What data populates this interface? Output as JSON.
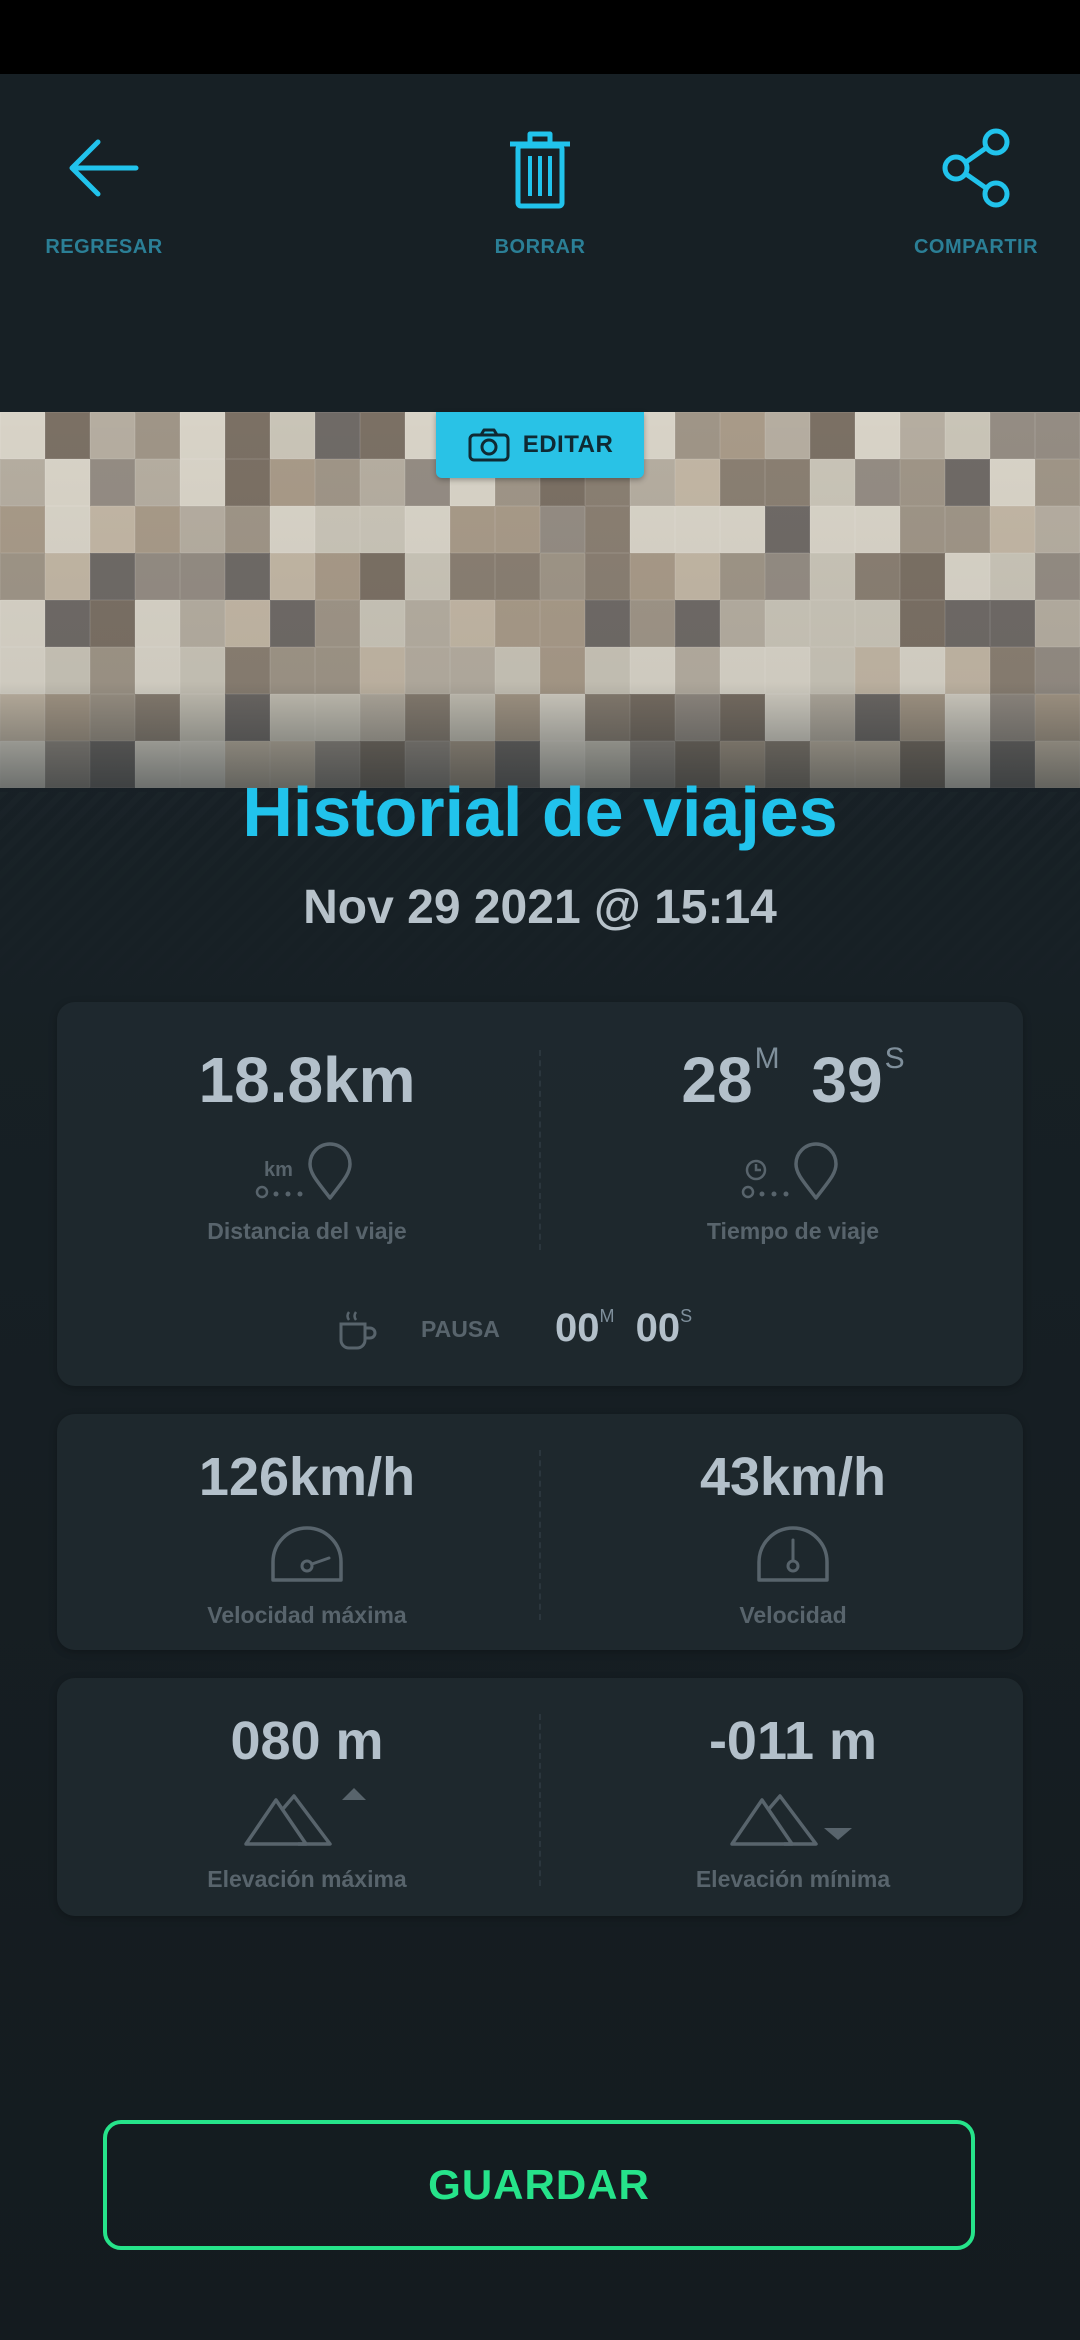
{
  "colors": {
    "accent": "#21c3ec",
    "save": "#26e38a",
    "muted_label": "#2b7f96",
    "value_text": "#b3c0ca",
    "background": "#172025",
    "card": "#20292f"
  },
  "topbar": {
    "back": {
      "label": "REGRESAR",
      "icon": "arrow-left-icon"
    },
    "delete": {
      "label": "BORRAR",
      "icon": "trash-icon"
    },
    "share": {
      "label": "COMPARTIR",
      "icon": "share-icon"
    }
  },
  "hero": {
    "edit_label": "EDITAR",
    "edit_icon": "camera-icon",
    "image": "blurred-photo"
  },
  "header": {
    "title": "Historial de viajes",
    "datetime": "Nov 29 2021 @ 15:14"
  },
  "trip": {
    "distance": {
      "value": "18.8km",
      "label": "Distancia del viaje",
      "icon_text": "km"
    },
    "time": {
      "minutes": "28",
      "minutes_unit": "M",
      "seconds": "39",
      "seconds_unit": "S",
      "label": "Tiempo de viaje"
    },
    "pause": {
      "label": "PAUSA",
      "minutes": "00",
      "minutes_unit": "M",
      "seconds": "00",
      "seconds_unit": "S"
    }
  },
  "speed": {
    "max": {
      "value": "126km/h",
      "label": "Velocidad máxima"
    },
    "avg": {
      "value": "43km/h",
      "label": "Velocidad"
    }
  },
  "elevation": {
    "max": {
      "value": "080 m",
      "label": "Elevación máxima"
    },
    "min": {
      "value": "-011 m",
      "label": "Elevación mínima"
    }
  },
  "save_label": "GUARDAR"
}
